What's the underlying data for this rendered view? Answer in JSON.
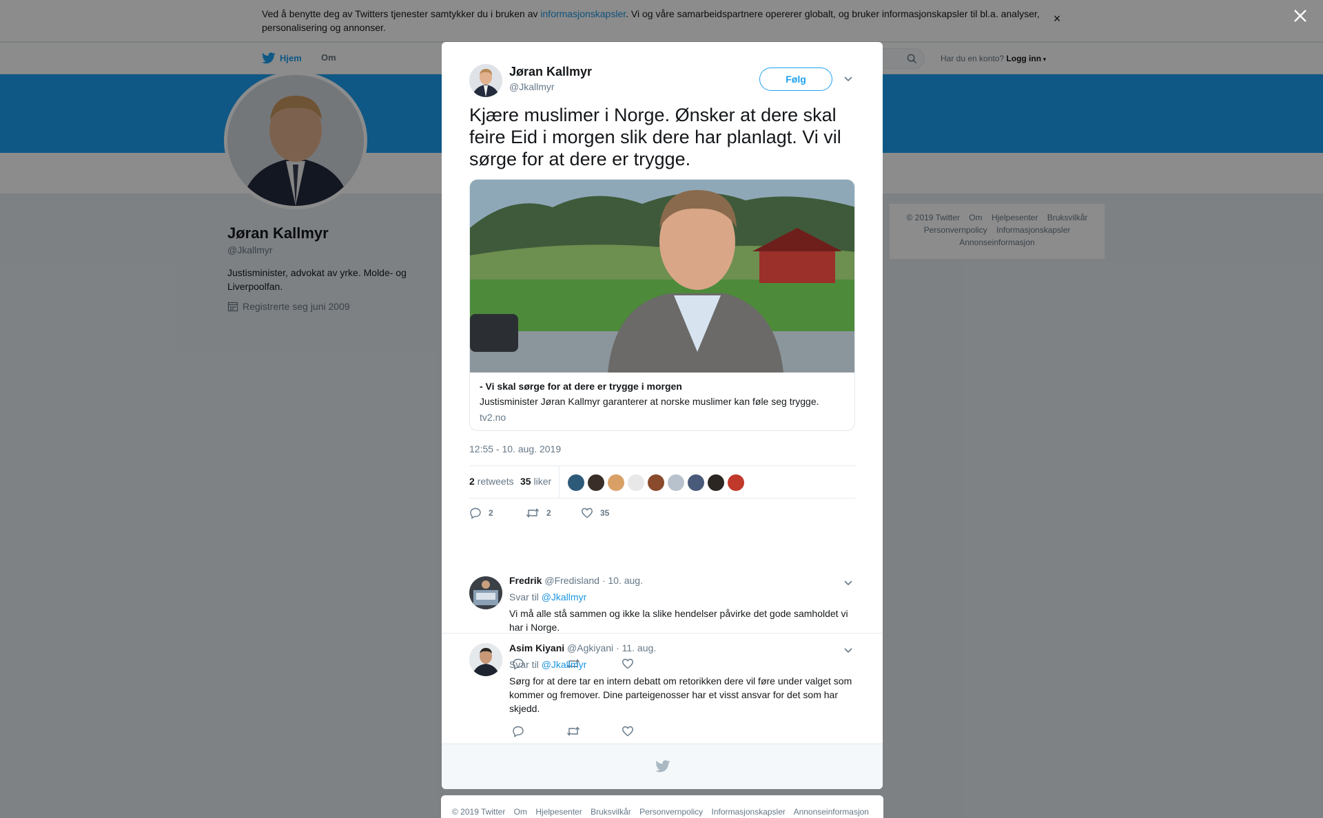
{
  "cookie": {
    "text_before": "Ved å benytte deg av Twitters tjenester samtykker du i bruken av ",
    "link": "informasjonskapsler",
    "text_after": ". Vi og våre samarbeidspartnere opererer globalt, og bruker informasjonskapsler til bl.a. analyser, personalisering og annonser."
  },
  "nav": {
    "home": "Hjem",
    "about": "Om",
    "login_prompt": "Har du en konto?",
    "login": "Logg inn"
  },
  "profile": {
    "name": "Jøran Kallmyr",
    "handle": "@Jkallmyr",
    "bio": "Justisminister, advokat av yrke. Molde- og Liverpoolfan.",
    "joined": "Registrerte seg juni 2009"
  },
  "right_footer": {
    "links": [
      "© 2019 Twitter",
      "Om",
      "Hjelpesenter",
      "Bruksvilkår",
      "Personvernpolicy",
      "Informasjonskapsler",
      "Annonseinformasjon"
    ]
  },
  "tweet": {
    "author_name": "Jøran Kallmyr",
    "author_handle": "@Jkallmyr",
    "follow_label": "Følg",
    "text": "Kjære muslimer i Norge. Ønsker at dere skal feire Eid i morgen slik dere har planlagt. Vi vil sørge for at dere er trygge.",
    "card": {
      "title": "- Vi skal sørge for at dere er trygge i morgen",
      "description": "Justisminister Jøran Kallmyr garanterer at norske muslimer kan føle seg trygge.",
      "domain": "tv2.no"
    },
    "timestamp": "12:55 - 10. aug. 2019",
    "retweets_count": "2",
    "retweets_label": "retweets",
    "likes_count": "35",
    "likes_label": "liker",
    "likers_colors": [
      "#2e5a7a",
      "#3a2f28",
      "#d9a066",
      "#e8e8e8",
      "#8a4a2c",
      "#b8c2cc",
      "#4a5a7a",
      "#2b2622",
      "#c0392b"
    ],
    "action_replies": "2",
    "action_retweets": "2",
    "action_likes": "35"
  },
  "replies": [
    {
      "name": "Fredrik",
      "handle": "@Fredisland",
      "date": "· 10. aug.",
      "reply_to_label": "Svar til",
      "reply_to": "@Jkallmyr",
      "text": "Vi må alle stå sammen og ikke la slike hendelser påvirke det gode samholdet vi har i Norge."
    },
    {
      "name": "Asim Kiyani",
      "handle": "@Agkiyani",
      "date": "· 11. aug.",
      "reply_to_label": "Svar til",
      "reply_to": "@Jkallmyr",
      "text": "Sørg for at dere tar en intern debatt om retorikken dere vil føre under valget som kommer og fremover. Dine parteigenosser har et visst ansvar for det som har skjedd."
    }
  ],
  "page_footer": {
    "links": [
      "© 2019 Twitter",
      "Om",
      "Hjelpesenter",
      "Bruksvilkår",
      "Personvernpolicy",
      "Informasjonskapsler",
      "Annonseinformasjon"
    ]
  },
  "colors": {
    "brand": "#1da1f2",
    "link": "#1b95e0",
    "text": "#14171a",
    "muted": "#657786"
  }
}
